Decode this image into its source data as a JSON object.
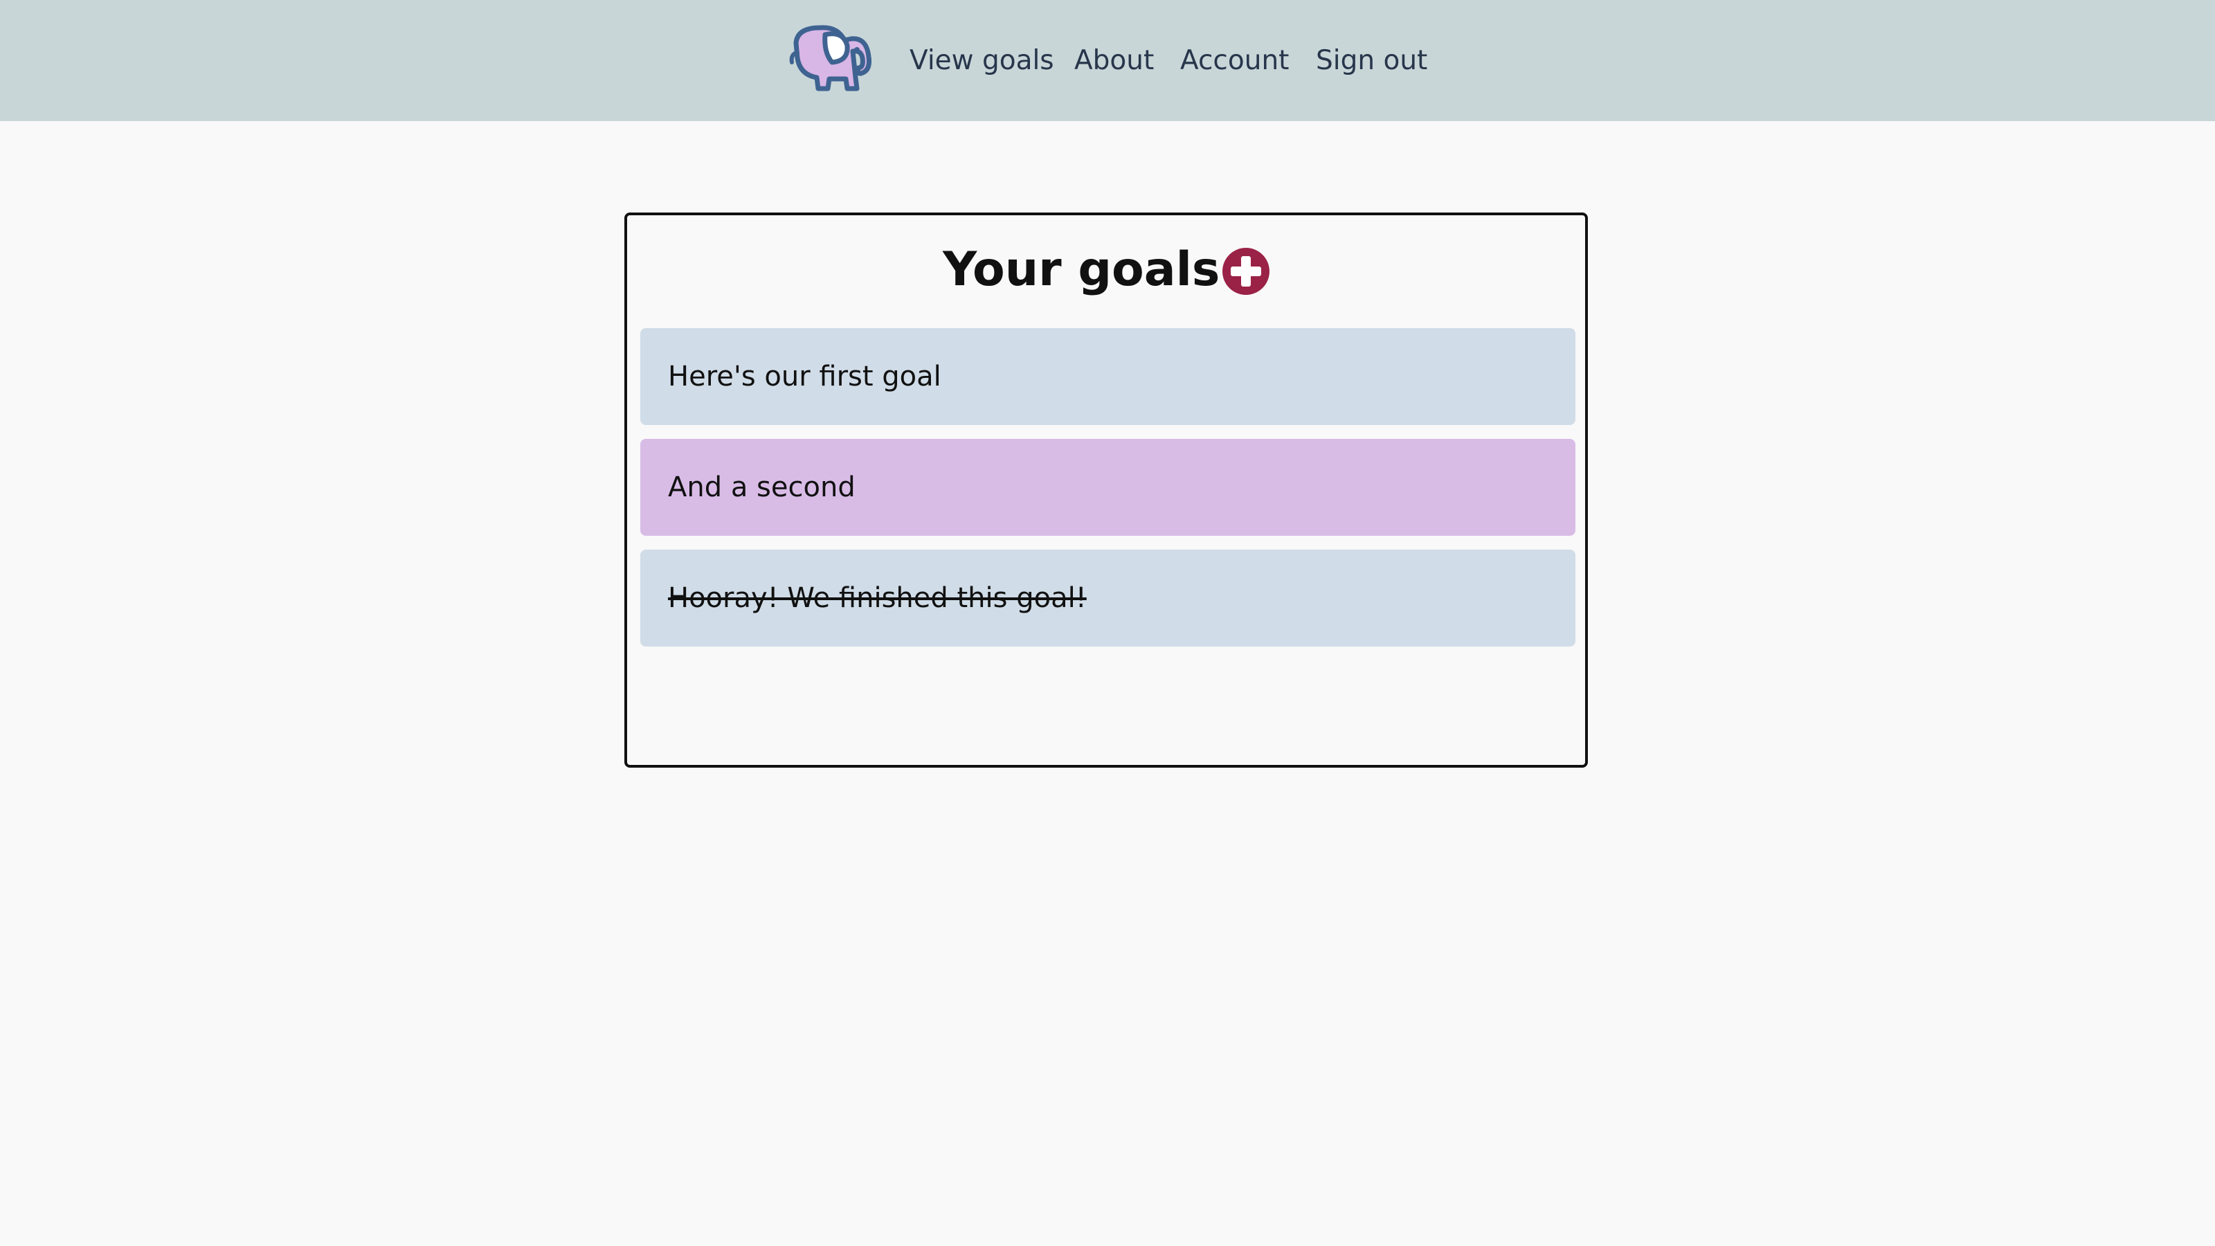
{
  "nav": {
    "logo_icon": "elephant-icon",
    "links": [
      {
        "label": "View goals"
      },
      {
        "label": "About"
      },
      {
        "label": "Account"
      },
      {
        "label": "Sign out"
      }
    ],
    "background": "#c8d6d8",
    "text_color": "#27364b"
  },
  "main": {
    "title": "Your goals",
    "add_icon": "plus-circle-icon",
    "accent": "#9b2247",
    "goals": [
      {
        "text": "Here's our first goal",
        "completed": false,
        "color": "#d0dce7"
      },
      {
        "text": "And a second",
        "completed": false,
        "color": "#d8bce6"
      },
      {
        "text": "Hooray! We finished this goal!",
        "completed": true,
        "color": "#d0dce7"
      }
    ]
  }
}
